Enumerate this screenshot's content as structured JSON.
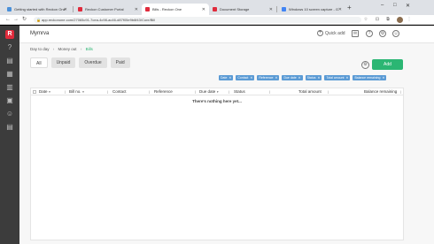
{
  "browser": {
    "tabs": [
      {
        "label": "Getting started with Reckon One",
        "favicon_color": "#4a90d9"
      },
      {
        "label": "Reckon Customer Portal",
        "favicon_color": "#e02b3c"
      },
      {
        "label": "Bills - Reckon One",
        "favicon_color": "#e02b3c",
        "active": true
      },
      {
        "label": "Document Storage",
        "favicon_color": "#e02b3c"
      },
      {
        "label": "Windows 10 screen capture - G",
        "favicon_color": "#4285f4"
      }
    ],
    "url": "app.reckonone.com/27065c91-7cea-4c98-ac46-d87f05e9b6f43/Core/Bill",
    "new_tab": "+",
    "window_controls": [
      "–",
      "□",
      "✕"
    ],
    "nav": {
      "back": "←",
      "forward": "→",
      "reload": "↻",
      "lock": "🔒"
    },
    "omni_icons": [
      "☆",
      "⊡",
      "⧉",
      "⋮"
    ]
  },
  "leftnav": {
    "logo": "R",
    "icons": [
      "search-icon",
      "dashboard-icon",
      "calendar-icon",
      "bank-icon",
      "document-icon",
      "contacts-icon",
      "reports-icon"
    ],
    "glyphs": [
      "?",
      "▤",
      "▦",
      "▥",
      "▣",
      "☺",
      "▤"
    ]
  },
  "header": {
    "company": "Mymrva",
    "quick_add": "Quick add",
    "quick_add_plus": "+",
    "icons": [
      "mail-icon",
      "help-icon",
      "settings-icon",
      "profile-icon"
    ],
    "icon_glyphs": [
      "✉",
      "?",
      "⚙",
      "☺"
    ]
  },
  "breadcrumb": {
    "items": [
      "Day to day",
      "Money out",
      "Bills"
    ],
    "separator": "›"
  },
  "filters": [
    "All",
    "Unpaid",
    "Overdue",
    "Paid"
  ],
  "active_filter": "All",
  "gear_glyph": "⚙",
  "add_label": "Add",
  "chips": [
    "Date",
    "Contact",
    "Reference",
    "Due date",
    "Status",
    "Total amount",
    "Balance remaining"
  ],
  "chip_close": "✕",
  "table": {
    "columns": [
      "Date",
      "Bill no.",
      "Contact",
      "Reference",
      "Due date",
      "Status",
      "Total amount",
      "Balance remaining"
    ],
    "sort_arrow": "▼",
    "col_sep": "|",
    "empty_message": "There's nothing here yet..."
  },
  "colors": {
    "brand": "#e02b3c",
    "accent": "#2bb673",
    "chip": "#5b9bd5",
    "sidebar": "#3c3c3c"
  }
}
